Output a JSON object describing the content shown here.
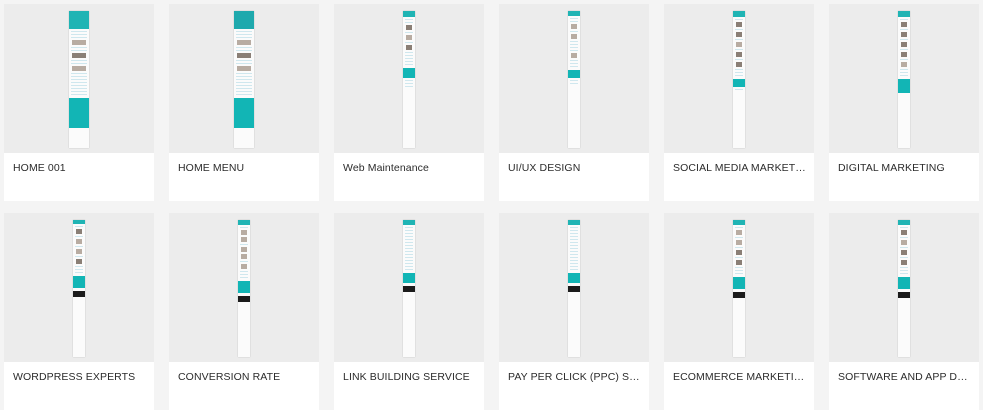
{
  "pages": [
    {
      "title": "HOME 001"
    },
    {
      "title": "HOME MENU"
    },
    {
      "title": "Web Maintenance"
    },
    {
      "title": "UI/UX DESIGN"
    },
    {
      "title": "SOCIAL MEDIA MARKETING"
    },
    {
      "title": "DIGITAL MARKETING"
    },
    {
      "title": "WORDPRESS EXPERTS"
    },
    {
      "title": "CONVERSION RATE"
    },
    {
      "title": "LINK BUILDING SERVICE"
    },
    {
      "title": "PAY PER CLICK (PPC) SERVIC..."
    },
    {
      "title": "ECOMMERCE MARKETING"
    },
    {
      "title": "SOFTWARE AND APP DEVEL..."
    }
  ],
  "colors": {
    "accent_teal": "#12b5b5",
    "thumb_bg": "#ececec",
    "page_bg": "#f4f4f4"
  }
}
